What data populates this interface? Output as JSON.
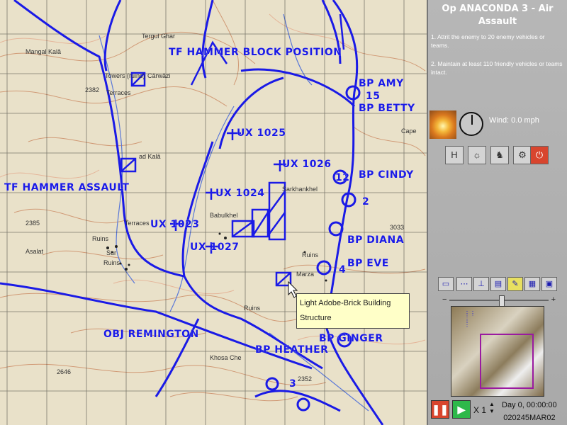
{
  "panel": {
    "title": "Op ANACONDA 3 - Air Assault",
    "objective_1": "1. Attrit the enemy to 20 enemy vehicles or teams.",
    "objective_2": "2. Maintain at least 110 friendly vehicles or teams intact.",
    "wind": "Wind: 0.0 mph",
    "speed": "X 1",
    "time": "Day 0, 00:00:00",
    "date": "020245MAR02"
  },
  "map": {
    "labels": {
      "hammer_block": "TF HAMMER BLOCK POSITION",
      "hammer_assault": "TF HAMMER ASSAULT",
      "bp_amy": "BP AMY",
      "bp_betty": "BP BETTY",
      "bp_cindy": "BP CINDY",
      "bp_diana": "BP DIANA",
      "bp_eve": "BP EVE",
      "bp_ginger": "BP GINGER",
      "bp_heather": "BP HEATHER",
      "obj_remington": "OBJ REMINGTON",
      "ux1023": "UX 1023",
      "ux1024": "UX 1024",
      "ux1025": "UX 1025",
      "ux1026": "UX 1026",
      "ux1027": "UX 1027",
      "n15": "15",
      "n12": "12",
      "n2": "2",
      "n4": "4",
      "n3": "3"
    },
    "places": {
      "mangal": "Mangal Kalā",
      "tergul": "Tergul Ghar",
      "carwazi": "Cārwāzi",
      "towers": "Towers (ruins)",
      "terraces1": "Terraces",
      "ad_kala": "ad Kalā",
      "babulkhel": "Babulkhel",
      "serkhankhel": "Sarkhankhel",
      "terraces2": "Terraces",
      "ruins1": "Ruins",
      "sur": "Sur",
      "ruins2": "Ruins",
      "asalat": "Asalat",
      "ruins3": "Ruins",
      "ruins4": "Ruins",
      "marza": "Marza",
      "khosa": "Khosa Che",
      "cape": "Cape",
      "n2382": "2382",
      "n2385": "2385",
      "n2646": "2646",
      "n3033": "3033",
      "n2352": "2352"
    },
    "tooltip": {
      "line1": "Light Adobe-Brick Building",
      "line2": "Structure"
    }
  },
  "colors": {
    "unit_blue": "#1a1ae6",
    "pause_red": "#d8452e",
    "play_green": "#2eb84a",
    "viewport": "#9a1aa0"
  },
  "icons": [
    "history-icon",
    "database-icon",
    "units-icon",
    "settings-icon",
    "power-icon",
    "pause-icon",
    "play-icon"
  ]
}
